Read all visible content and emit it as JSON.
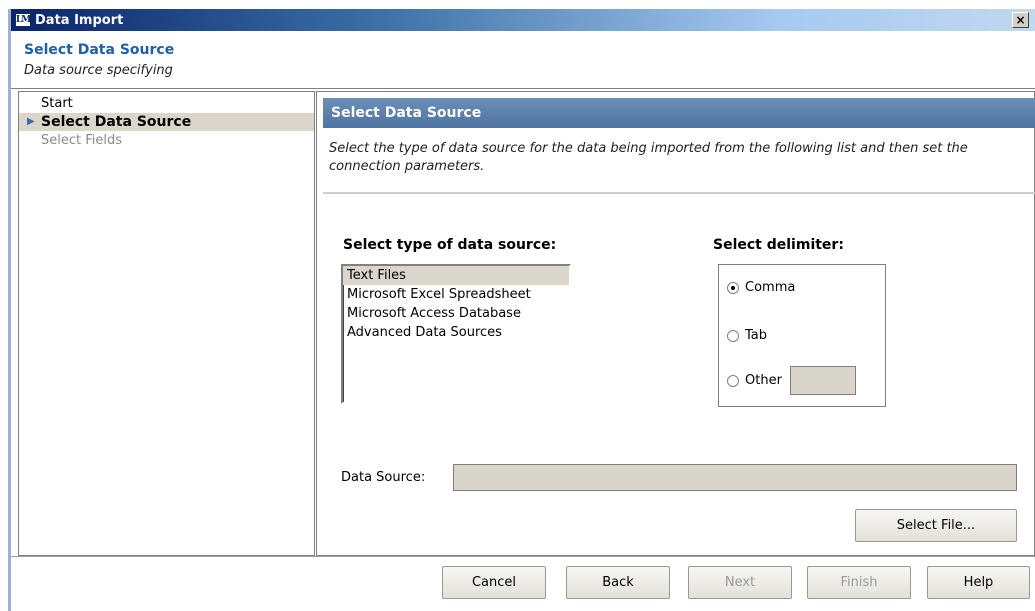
{
  "window": {
    "icon_text": "LM",
    "title": "Data Import",
    "close_glyph": "×"
  },
  "header": {
    "title": "Select Data Source",
    "subtitle": "Data source specifying"
  },
  "nav": {
    "items": [
      {
        "label": "Start",
        "state": "normal"
      },
      {
        "label": "Select Data Source",
        "state": "selected"
      },
      {
        "label": "Select Fields",
        "state": "disabled"
      }
    ],
    "arrow_glyph": "▶"
  },
  "panel": {
    "title": "Select Data Source",
    "description": "Select the type of data source for the data being imported from the following list and then set the connection parameters.",
    "source_label": "Select type of data source:",
    "sources": [
      "Text Files",
      "Microsoft Excel Spreadsheet",
      "Microsoft Access Database",
      "Advanced Data Sources"
    ],
    "selected_source": "Text Files",
    "delimiter_label": "Select delimiter:",
    "delimiters": [
      {
        "label": "Comma",
        "checked": true
      },
      {
        "label": "Tab",
        "checked": false
      },
      {
        "label": "Other",
        "checked": false
      }
    ],
    "other_value": "",
    "data_source_label": "Data Source:",
    "data_source_value": "",
    "select_file_label": "Select File..."
  },
  "footer": {
    "cancel": "Cancel",
    "back": "Back",
    "next": "Next",
    "finish": "Finish",
    "help": "Help"
  },
  "colors": {
    "accent": "#1f5ea8",
    "panel_header": "#5a7fae",
    "selection": "#dad6cc"
  }
}
